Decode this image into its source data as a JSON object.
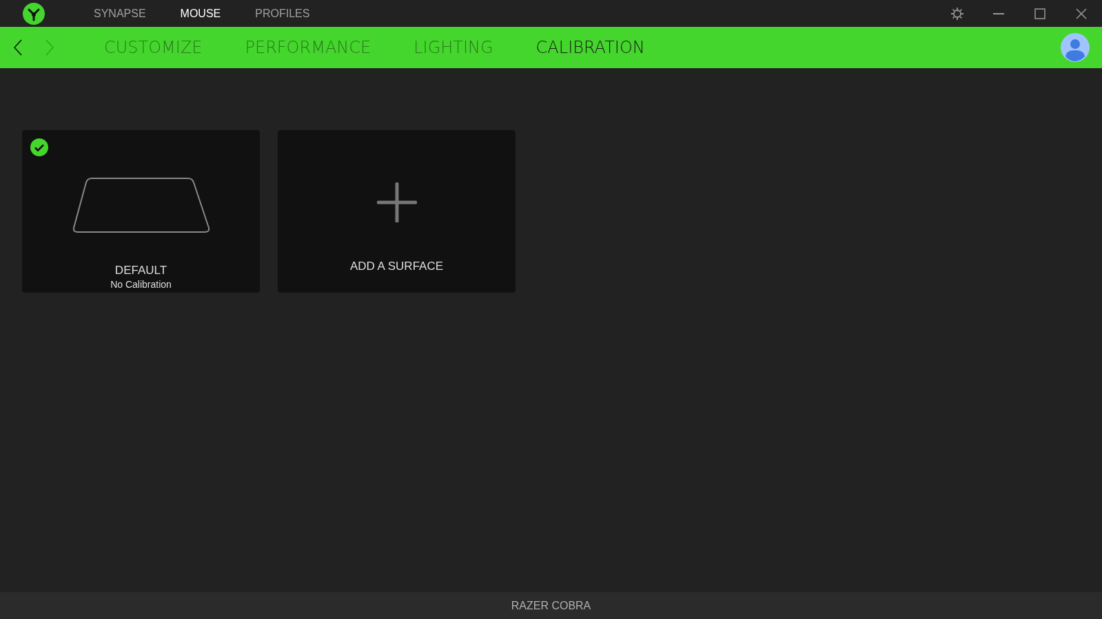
{
  "top_tabs": [
    {
      "label": "SYNAPSE",
      "selected": false
    },
    {
      "label": "MOUSE",
      "selected": true
    },
    {
      "label": "PROFILES",
      "selected": false
    }
  ],
  "nav": {
    "back_disabled": false,
    "forward_disabled": true
  },
  "sub_tabs": [
    {
      "label": "CUSTOMIZE",
      "selected": false
    },
    {
      "label": "PERFORMANCE",
      "selected": false
    },
    {
      "label": "LIGHTING",
      "selected": false
    },
    {
      "label": "CALIBRATION",
      "selected": true
    }
  ],
  "surfaces": [
    {
      "kind": "surface",
      "title": "DEFAULT",
      "subtitle": "No Calibration",
      "selected": true
    },
    {
      "kind": "add",
      "title": "ADD A SURFACE"
    }
  ],
  "status_bar": {
    "device": "RAZER COBRA"
  }
}
